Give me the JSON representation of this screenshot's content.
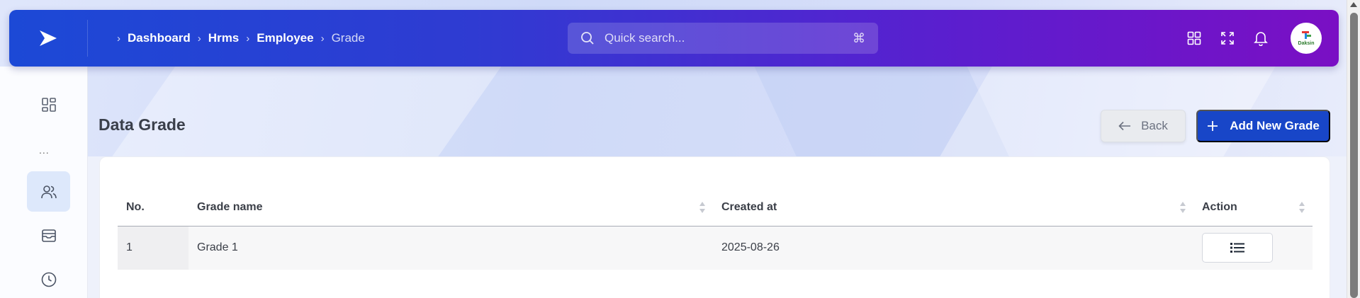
{
  "breadcrumb": {
    "items": [
      "Dashboard",
      "Hrms",
      "Employee"
    ],
    "current": "Grade"
  },
  "search": {
    "placeholder": "Quick search...",
    "shortcut": "⌘"
  },
  "header": {
    "avatar_text": "Daksin"
  },
  "page": {
    "title": "Data Grade"
  },
  "actions": {
    "back_label": "Back",
    "add_label": "Add New Grade"
  },
  "table": {
    "columns": [
      "No.",
      "Grade name",
      "Created at",
      "Action"
    ],
    "rows": [
      {
        "no": "1",
        "grade_name": "Grade 1",
        "created_at": "2025-08-26"
      }
    ]
  },
  "sidebar": {
    "more_label": "..."
  },
  "colors": {
    "accent": "#1846c8",
    "header_start": "#1c49d6",
    "header_end": "#7a0fc4"
  }
}
